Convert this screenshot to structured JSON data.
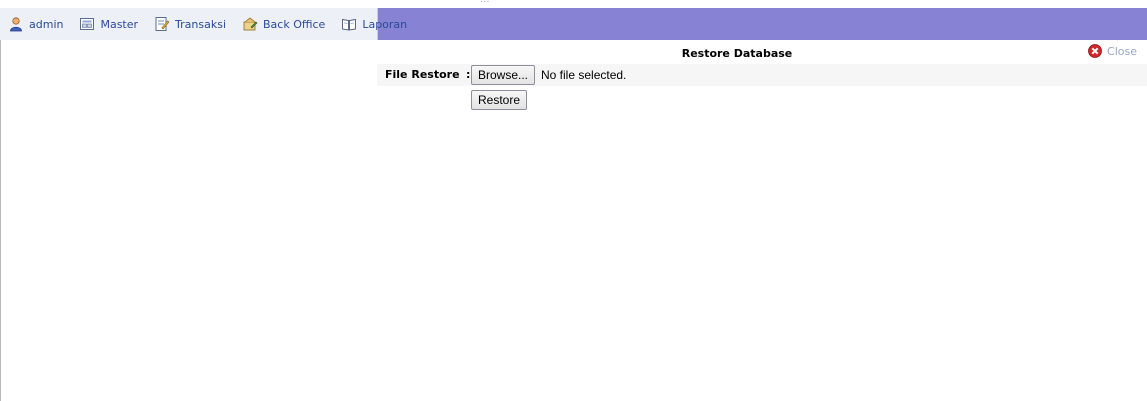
{
  "top_strip": {
    "text": "..."
  },
  "menu": {
    "items": [
      {
        "label": "admin",
        "icon": "user-icon"
      },
      {
        "label": "Master",
        "icon": "master-icon"
      },
      {
        "label": "Transaksi",
        "icon": "transaction-icon"
      },
      {
        "label": "Back Office",
        "icon": "back-office-icon"
      },
      {
        "label": "Laporan",
        "icon": "report-book-icon"
      }
    ]
  },
  "panel": {
    "title": "Restore Database",
    "close_label": "Close"
  },
  "form": {
    "file_label": "File Restore",
    "colon": ":",
    "browse_label": "Browse...",
    "file_status": "No file selected.",
    "restore_label": "Restore"
  },
  "colors": {
    "menubar": "#8882d4",
    "menu_left_bg": "#eef0f7",
    "menu_text": "#2a4a9a",
    "close_icon": "#d0282a"
  }
}
